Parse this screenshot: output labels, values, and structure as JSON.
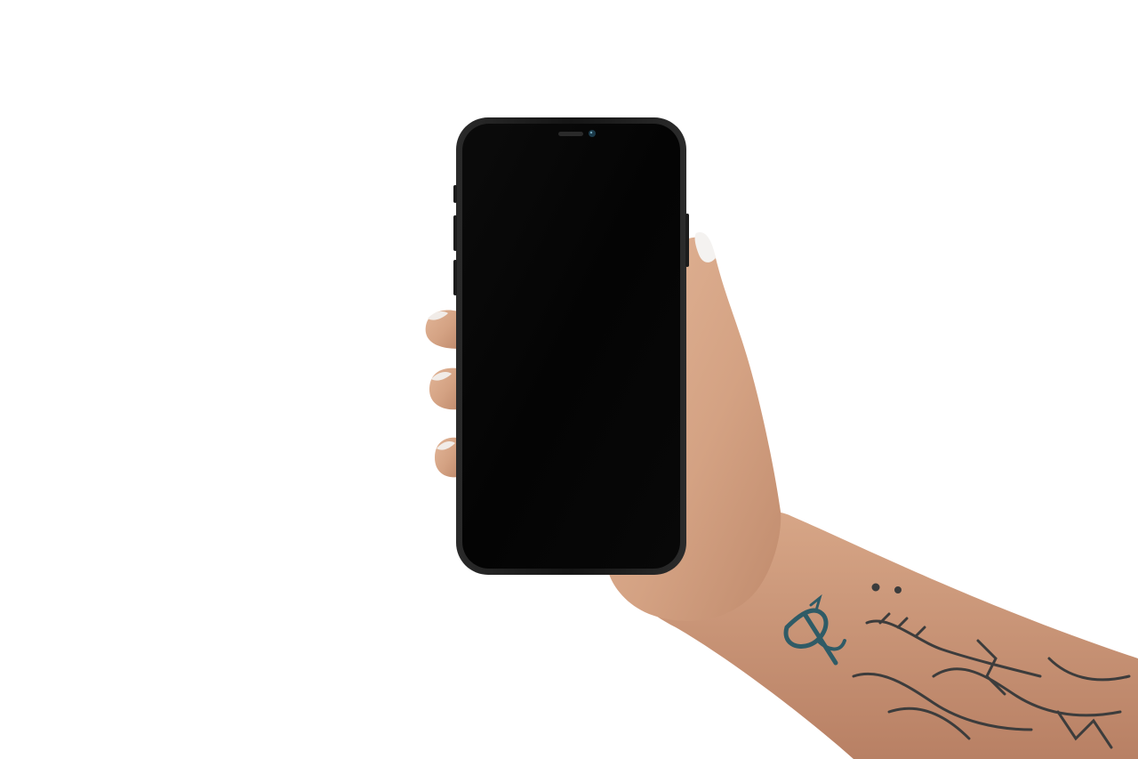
{
  "scene": {
    "background_color": "#ffffff",
    "subject": "hand-holding-smartphone",
    "phone": {
      "screen_state": "off",
      "frame_color": "#1a1a1a",
      "screen_color": "#050505",
      "camera_lens_color": "#1b3a4a"
    },
    "hand": {
      "skin_color": "#d9a989",
      "skin_shadow_color": "#b98466",
      "nail_color": "#f4f2f0"
    },
    "tattoo": {
      "ink_color": "#3c3c3c",
      "accent_color": "#2f5b66"
    }
  }
}
